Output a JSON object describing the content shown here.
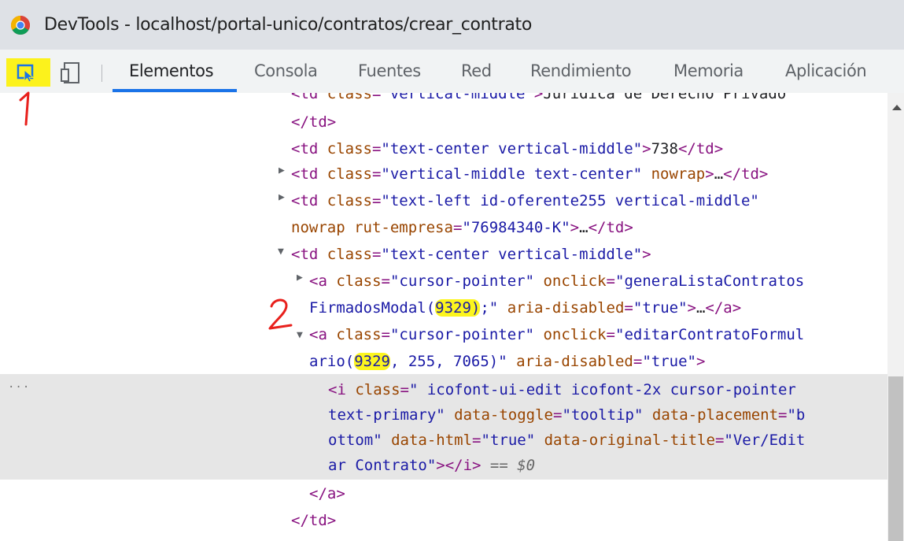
{
  "window": {
    "title": "DevTools - localhost/portal-unico/contratos/crear_contrato"
  },
  "toolbar": {
    "inspect_icon": "select-element-icon",
    "device_icon": "device-toggle-icon",
    "tabs": [
      {
        "label": "Elementos",
        "active": true
      },
      {
        "label": "Consola",
        "active": false
      },
      {
        "label": "Fuentes",
        "active": false
      },
      {
        "label": "Red",
        "active": false
      },
      {
        "label": "Rendimiento",
        "active": false
      },
      {
        "label": "Memoria",
        "active": false
      },
      {
        "label": "Aplicación",
        "active": false
      }
    ]
  },
  "annotations": {
    "one": "1",
    "two": "2"
  },
  "elements": {
    "lines": [
      {
        "text": "<td class=\"vertical-middle\">Jurídica de Derecho Privado"
      },
      {
        "text": "</td>"
      },
      {
        "text": "<td class=\"text-center vertical-middle\">738</td>"
      },
      {
        "text": "<td class=\"vertical-middle text-center\" nowrap>…</td>"
      },
      {
        "text": "<td class=\"text-left id-oferente255 vertical-middle\""
      },
      {
        "text": "nowrap rut-empresa=\"76984340-K\">…</td>"
      },
      {
        "text": "<td class=\"text-center vertical-middle\">"
      },
      {
        "text": "<a class=\"cursor-pointer\" onclick=\"generaListaContratos"
      },
      {
        "text": "FirmadosModal(9329);\" aria-disabled=\"true\">…</a>"
      },
      {
        "text": "<a class=\"cursor-pointer\" onclick=\"editarContratoFormul"
      },
      {
        "text": "ario(9329, 255, 7065)\" aria-disabled=\"true\">"
      },
      {
        "text": "<i class=\" icofont-ui-edit icofont-2x cursor-pointer"
      },
      {
        "text": "text-primary\" data-toggle=\"tooltip\" data-placement=\"b"
      },
      {
        "text": "ottom\" data-html=\"true\" data-original-title=\"Ver/Edit"
      },
      {
        "text": "ar Contrato\"></i> == $0"
      },
      {
        "text": "</a>"
      },
      {
        "text": "</td>"
      }
    ],
    "highlighted_value": "9329",
    "selected_node_ref": "== $0",
    "more_indicator": "..."
  },
  "colors": {
    "tag": "#881280",
    "attr_name": "#994500",
    "attr_value": "#1a1aa6",
    "highlight": "#fcf51e",
    "annotation": "#e8201c",
    "active_tab": "#1a73e8"
  }
}
